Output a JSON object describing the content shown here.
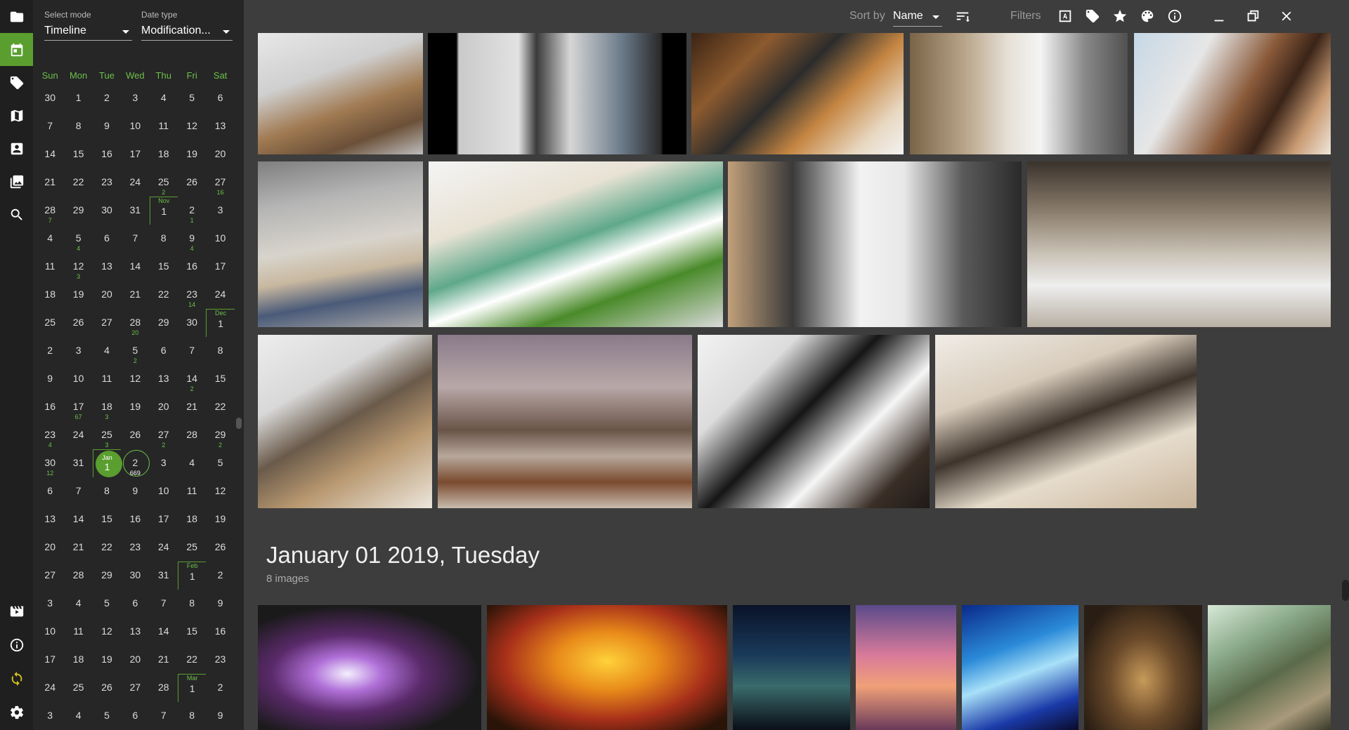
{
  "sidebar": {
    "icons": [
      "folder-icon",
      "calendar-icon",
      "tag-icon",
      "map-icon",
      "portrait-icon",
      "gallery-icon",
      "search-icon"
    ],
    "bottom_icons": [
      "slideshow-icon",
      "info-icon",
      "sync-icon",
      "settings-icon"
    ],
    "accent": "#5a9e2f"
  },
  "calendar": {
    "select_mode_label": "Select mode",
    "select_mode_value": "Timeline",
    "date_type_label": "Date type",
    "date_type_value": "Modification...",
    "weekdays": [
      "Sun",
      "Mon",
      "Tue",
      "Wed",
      "Thu",
      "Fri",
      "Sat"
    ],
    "weeks": [
      [
        {
          "d": "30"
        },
        {
          "d": "1"
        },
        {
          "d": "2"
        },
        {
          "d": "3"
        },
        {
          "d": "4"
        },
        {
          "d": "5"
        },
        {
          "d": "6"
        }
      ],
      [
        {
          "d": "7"
        },
        {
          "d": "8"
        },
        {
          "d": "9"
        },
        {
          "d": "10"
        },
        {
          "d": "11"
        },
        {
          "d": "12"
        },
        {
          "d": "13"
        }
      ],
      [
        {
          "d": "14"
        },
        {
          "d": "15"
        },
        {
          "d": "16"
        },
        {
          "d": "17"
        },
        {
          "d": "18"
        },
        {
          "d": "19"
        },
        {
          "d": "20"
        }
      ],
      [
        {
          "d": "21"
        },
        {
          "d": "22"
        },
        {
          "d": "23"
        },
        {
          "d": "24"
        },
        {
          "d": "25",
          "c": "2"
        },
        {
          "d": "26"
        },
        {
          "d": "27",
          "c": "16"
        }
      ],
      [
        {
          "d": "28",
          "c": "7"
        },
        {
          "d": "29"
        },
        {
          "d": "30"
        },
        {
          "d": "31"
        },
        {
          "d": "1",
          "m": "Nov"
        },
        {
          "d": "2",
          "c": "1"
        },
        {
          "d": "3"
        }
      ],
      [
        {
          "d": "4"
        },
        {
          "d": "5",
          "c": "4"
        },
        {
          "d": "6"
        },
        {
          "d": "7"
        },
        {
          "d": "8"
        },
        {
          "d": "9",
          "c": "4"
        },
        {
          "d": "10"
        }
      ],
      [
        {
          "d": "11"
        },
        {
          "d": "12",
          "c": "3"
        },
        {
          "d": "13"
        },
        {
          "d": "14"
        },
        {
          "d": "15"
        },
        {
          "d": "16"
        },
        {
          "d": "17"
        }
      ],
      [
        {
          "d": "18"
        },
        {
          "d": "19"
        },
        {
          "d": "20"
        },
        {
          "d": "21"
        },
        {
          "d": "22"
        },
        {
          "d": "23",
          "c": "14"
        },
        {
          "d": "24"
        }
      ],
      [
        {
          "d": "25"
        },
        {
          "d": "26"
        },
        {
          "d": "27"
        },
        {
          "d": "28",
          "c": "20"
        },
        {
          "d": "29"
        },
        {
          "d": "30"
        },
        {
          "d": "1",
          "m": "Dec"
        }
      ],
      [
        {
          "d": "2"
        },
        {
          "d": "3"
        },
        {
          "d": "4"
        },
        {
          "d": "5",
          "c": "2"
        },
        {
          "d": "6"
        },
        {
          "d": "7"
        },
        {
          "d": "8"
        }
      ],
      [
        {
          "d": "9"
        },
        {
          "d": "10"
        },
        {
          "d": "11"
        },
        {
          "d": "12"
        },
        {
          "d": "13"
        },
        {
          "d": "14",
          "c": "2"
        },
        {
          "d": "15"
        }
      ],
      [
        {
          "d": "16"
        },
        {
          "d": "17",
          "c": "67"
        },
        {
          "d": "18",
          "c": "3"
        },
        {
          "d": "19"
        },
        {
          "d": "20"
        },
        {
          "d": "21"
        },
        {
          "d": "22"
        }
      ],
      [
        {
          "d": "23",
          "c": "4"
        },
        {
          "d": "24"
        },
        {
          "d": "25",
          "c": "3"
        },
        {
          "d": "26"
        },
        {
          "d": "27",
          "c": "2"
        },
        {
          "d": "28"
        },
        {
          "d": "29",
          "c": "2"
        }
      ],
      [
        {
          "d": "30",
          "c": "12"
        },
        {
          "d": "31"
        },
        {
          "d": "1",
          "m": "Jan",
          "sel": "filled"
        },
        {
          "d": "2",
          "c": "669",
          "sel": "ring"
        },
        {
          "d": "3"
        },
        {
          "d": "4"
        },
        {
          "d": "5"
        }
      ],
      [
        {
          "d": "6"
        },
        {
          "d": "7"
        },
        {
          "d": "8"
        },
        {
          "d": "9"
        },
        {
          "d": "10"
        },
        {
          "d": "11"
        },
        {
          "d": "12"
        }
      ],
      [
        {
          "d": "13"
        },
        {
          "d": "14"
        },
        {
          "d": "15"
        },
        {
          "d": "16"
        },
        {
          "d": "17"
        },
        {
          "d": "18"
        },
        {
          "d": "19"
        }
      ],
      [
        {
          "d": "20"
        },
        {
          "d": "21"
        },
        {
          "d": "22"
        },
        {
          "d": "23"
        },
        {
          "d": "24"
        },
        {
          "d": "25"
        },
        {
          "d": "26"
        }
      ],
      [
        {
          "d": "27"
        },
        {
          "d": "28"
        },
        {
          "d": "29"
        },
        {
          "d": "30"
        },
        {
          "d": "31"
        },
        {
          "d": "1",
          "m": "Feb"
        },
        {
          "d": "2"
        }
      ],
      [
        {
          "d": "3"
        },
        {
          "d": "4"
        },
        {
          "d": "5"
        },
        {
          "d": "6"
        },
        {
          "d": "7"
        },
        {
          "d": "8"
        },
        {
          "d": "9"
        }
      ],
      [
        {
          "d": "10"
        },
        {
          "d": "11"
        },
        {
          "d": "12"
        },
        {
          "d": "13"
        },
        {
          "d": "14"
        },
        {
          "d": "15"
        },
        {
          "d": "16"
        }
      ],
      [
        {
          "d": "17"
        },
        {
          "d": "18"
        },
        {
          "d": "19"
        },
        {
          "d": "20"
        },
        {
          "d": "21"
        },
        {
          "d": "22"
        },
        {
          "d": "23"
        }
      ],
      [
        {
          "d": "24"
        },
        {
          "d": "25"
        },
        {
          "d": "26"
        },
        {
          "d": "27"
        },
        {
          "d": "28"
        },
        {
          "d": "1",
          "m": "Mar"
        },
        {
          "d": "2"
        }
      ],
      [
        {
          "d": "3"
        },
        {
          "d": "4"
        },
        {
          "d": "5"
        },
        {
          "d": "6"
        },
        {
          "d": "7"
        },
        {
          "d": "8"
        },
        {
          "d": "9"
        }
      ]
    ]
  },
  "toolbar": {
    "sort_label": "Sort by",
    "sort_value": "Name",
    "filters_label": "Filters",
    "icons": [
      "sort-order-icon",
      "text-filter-icon",
      "tag-filter-icon",
      "star-filter-icon",
      "color-filter-icon",
      "info-icon",
      "minimize-icon",
      "restore-icon",
      "close-icon"
    ]
  },
  "gallery": {
    "section_title": "January 01 2019, Tuesday",
    "section_count": "8 images",
    "photo_names": [
      "interior-photo-1",
      "interior-photo-2",
      "interior-photo-3",
      "interior-photo-4",
      "interior-photo-5",
      "interior-photo-6",
      "interior-photo-7",
      "interior-photo-8",
      "interior-photo-9",
      "interior-photo-10",
      "interior-photo-11",
      "interior-photo-12",
      "interior-photo-13",
      "concert-photo",
      "autumn-window-photo",
      "night-sky-photo",
      "pink-sunset-photo",
      "blue-sky-photo",
      "library-photo",
      "greenhouse-photo"
    ]
  }
}
